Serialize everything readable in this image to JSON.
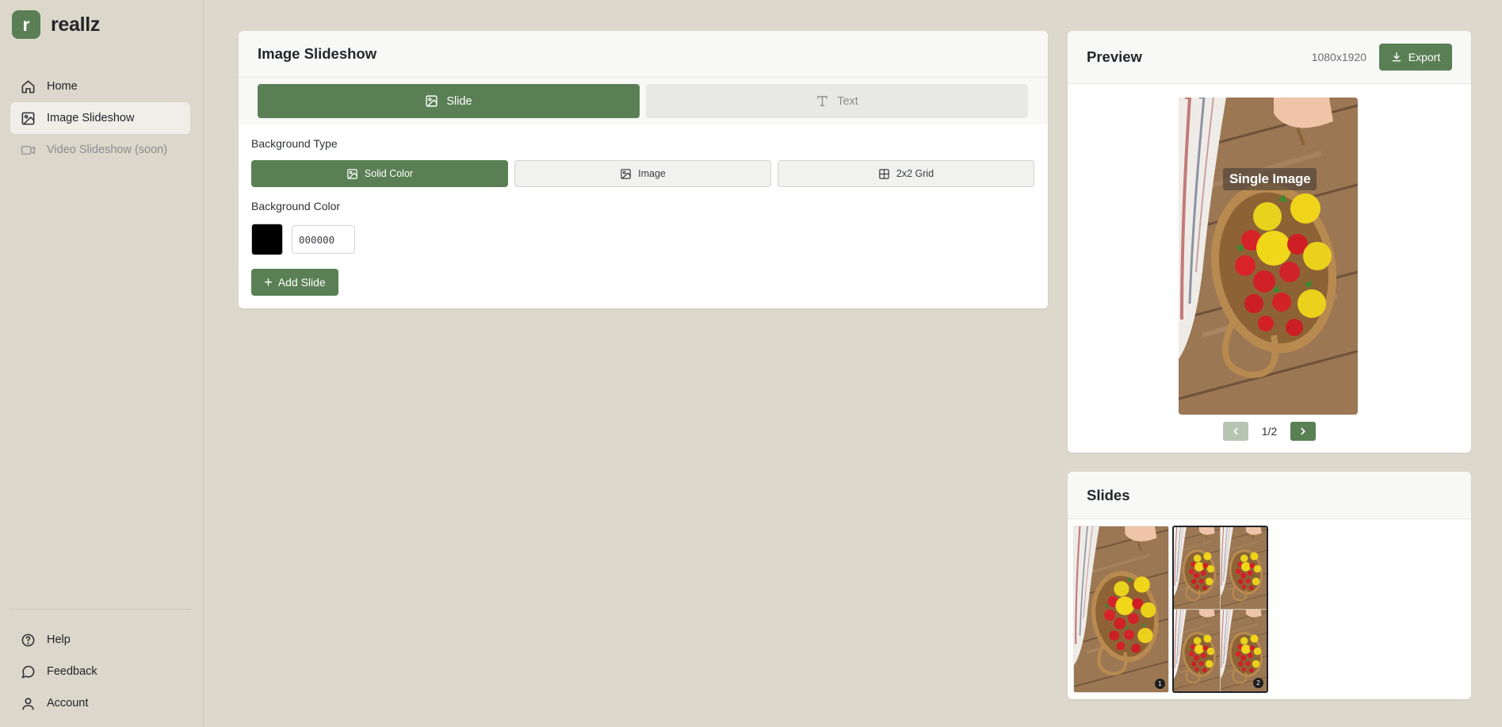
{
  "app": {
    "logo_letter": "r",
    "name": "reallz"
  },
  "sidebar": {
    "items": [
      {
        "label": "Home",
        "icon": "home-icon"
      },
      {
        "label": "Image Slideshow",
        "icon": "image-icon"
      },
      {
        "label": "Video Slideshow (soon)",
        "icon": "video-icon"
      }
    ],
    "bottom_items": [
      {
        "label": "Help",
        "icon": "help-icon"
      },
      {
        "label": "Feedback",
        "icon": "feedback-icon"
      },
      {
        "label": "Account",
        "icon": "user-icon"
      }
    ]
  },
  "editor": {
    "title": "Image Slideshow",
    "tabs": [
      {
        "label": "Slide",
        "icon": "image-icon"
      },
      {
        "label": "Text",
        "icon": "text-icon"
      }
    ],
    "background_type_label": "Background Type",
    "background_types": [
      {
        "label": "Solid Color",
        "icon": "image-icon"
      },
      {
        "label": "Image",
        "icon": "image-icon"
      },
      {
        "label": "2x2 Grid",
        "icon": "grid-icon"
      }
    ],
    "background_color_label": "Background Color",
    "background_color_value": "000000",
    "add_slide_label": "Add Slide"
  },
  "preview": {
    "title": "Preview",
    "dimensions": "1080x1920",
    "export_label": "Export",
    "overlay_text": "Single Image",
    "page_indicator": "1/2"
  },
  "slides": {
    "title": "Slides",
    "items": [
      {
        "number": "1"
      },
      {
        "number": "2"
      }
    ]
  },
  "colors": {
    "accent": "#5a7f55",
    "page_background": "#dcd9cc",
    "swatch": "#000000"
  }
}
